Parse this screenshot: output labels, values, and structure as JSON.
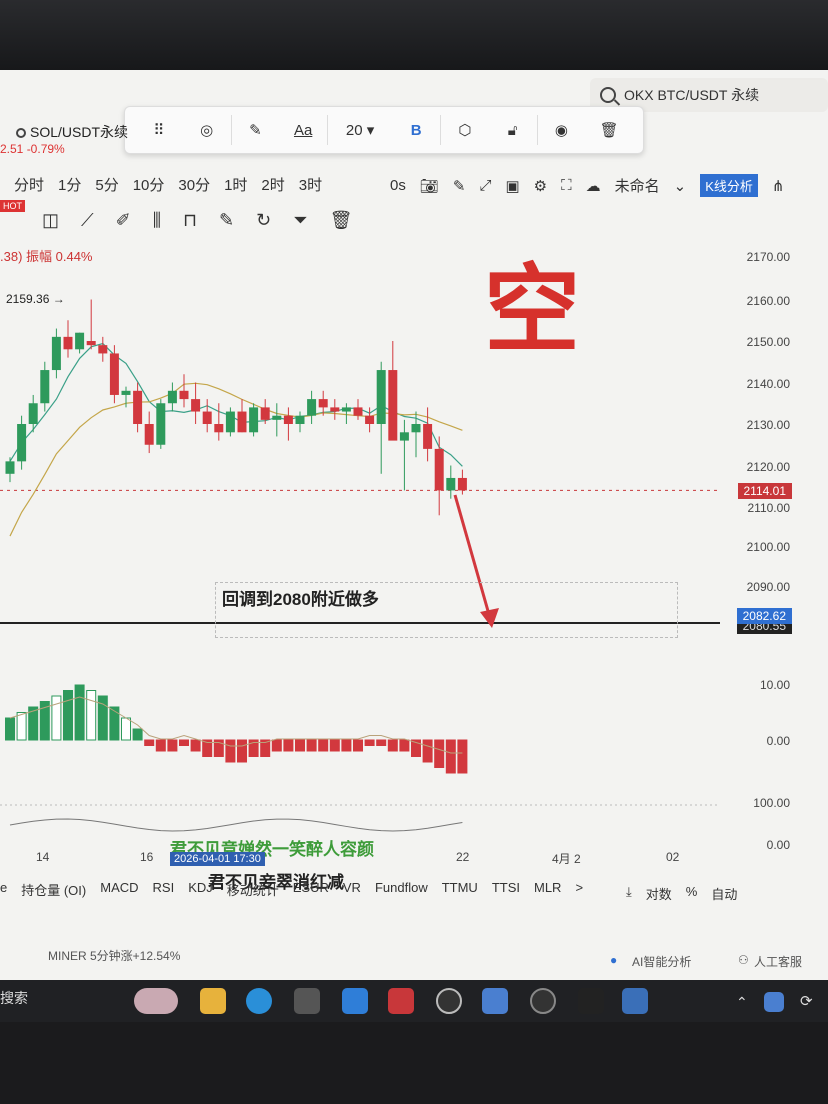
{
  "search": {
    "text": "OKX BTC/USDT 永续"
  },
  "drawing_toolbar": {
    "font_label": "Aa",
    "font_size": "20",
    "bold": "B"
  },
  "symbol": {
    "name": "SOL/USDT永续",
    "price_change": "2.51  -0.79%"
  },
  "intervals": [
    "分时",
    "1分",
    "5分",
    "10分",
    "30分",
    "1时",
    "2时",
    "3时"
  ],
  "toolbar": {
    "seconds": "0s",
    "layout_name": "未命名",
    "k_analysis": "K线分析"
  },
  "hot_badge": "HOT",
  "amplitude": ".38)  振幅 0.44%",
  "chart_note": "回调到2080附近做多",
  "big_mark": "空",
  "high_label": "2159.36 →",
  "chart_data": {
    "type": "candlestick",
    "y_ticks": [
      "2170.00",
      "2160.00",
      "2150.00",
      "2140.00",
      "2130.00",
      "2120.00",
      "2110.00",
      "2100.00",
      "2090.00"
    ],
    "current_price": "2114.01",
    "target_price": "2082.62",
    "target_price_under": "2080.55",
    "candles": [
      [
        2118,
        2122,
        2116,
        2121
      ],
      [
        2121,
        2132,
        2119,
        2130
      ],
      [
        2130,
        2137,
        2128,
        2135
      ],
      [
        2135,
        2145,
        2133,
        2143
      ],
      [
        2143,
        2153,
        2141,
        2151
      ],
      [
        2151,
        2155,
        2146,
        2148
      ],
      [
        2148,
        2152,
        2147,
        2152
      ],
      [
        2150,
        2160,
        2148,
        2149
      ],
      [
        2149,
        2151,
        2145,
        2147
      ],
      [
        2147,
        2149,
        2135,
        2137
      ],
      [
        2137,
        2139,
        2134,
        2138
      ],
      [
        2138,
        2140,
        2128,
        2130
      ],
      [
        2130,
        2133,
        2123,
        2125
      ],
      [
        2125,
        2136,
        2124,
        2135
      ],
      [
        2135,
        2140,
        2133,
        2138
      ],
      [
        2138,
        2142,
        2134,
        2136
      ],
      [
        2136,
        2140,
        2130,
        2133
      ],
      [
        2133,
        2136,
        2128,
        2130
      ],
      [
        2130,
        2135,
        2126,
        2128
      ],
      [
        2128,
        2134,
        2127,
        2133
      ],
      [
        2133,
        2136,
        2128,
        2128
      ],
      [
        2128,
        2135,
        2127,
        2134
      ],
      [
        2134,
        2136,
        2130,
        2131
      ],
      [
        2131,
        2135,
        2127,
        2132
      ],
      [
        2132,
        2134,
        2126,
        2130
      ],
      [
        2130,
        2133,
        2128,
        2132
      ],
      [
        2132,
        2138,
        2130,
        2136
      ],
      [
        2136,
        2138,
        2132,
        2134
      ],
      [
        2134,
        2136,
        2131,
        2133
      ],
      [
        2133,
        2135,
        2130,
        2134
      ],
      [
        2134,
        2136,
        2131,
        2132
      ],
      [
        2132,
        2134,
        2128,
        2130
      ],
      [
        2130,
        2145,
        2118,
        2143
      ],
      [
        2143,
        2150,
        2130,
        2126
      ],
      [
        2126,
        2131,
        2114,
        2128
      ],
      [
        2128,
        2133,
        2122,
        2130
      ],
      [
        2130,
        2134,
        2121,
        2124
      ],
      [
        2124,
        2127,
        2108,
        2114
      ],
      [
        2114,
        2120,
        2112,
        2117
      ],
      [
        2117,
        2119,
        2113,
        2114
      ]
    ],
    "macd_ticks": [
      "10.00",
      "0.00"
    ],
    "macd_hist": [
      4,
      5,
      6,
      7,
      8,
      9,
      10,
      9,
      8,
      6,
      4,
      2,
      -1,
      -2,
      -2,
      -1,
      -2,
      -3,
      -3,
      -4,
      -4,
      -3,
      -3,
      -2,
      -2,
      -2,
      -2,
      -2,
      -2,
      -2,
      -2,
      -1,
      -1,
      -2,
      -2,
      -3,
      -4,
      -5,
      -6,
      -6
    ],
    "kdj_ticks": [
      "100.00",
      "0.00"
    ],
    "x_labels": [
      "14",
      "16",
      "22",
      "4月 2",
      "02"
    ]
  },
  "date_box": "2026-04-01 17:30",
  "lyrics": {
    "line1": "君不见竞婵然一笑醉人容颜",
    "line2": "君不见妾翠消红减"
  },
  "indicators": [
    "e",
    "持仓量 (OI)",
    "MACD",
    "RSI",
    "KDJ",
    "移动统计",
    "ESUR",
    "VR",
    "Fundflow",
    "TTMU",
    "TTSI",
    "MLR",
    ">"
  ],
  "right_options": [
    "对数",
    "%",
    "自动"
  ],
  "status": {
    "left": "MINER  5分钟涨+12.54%",
    "ai": "AI智能分析",
    "support": "人工客服"
  },
  "taskbar": {
    "search": "搜索"
  }
}
